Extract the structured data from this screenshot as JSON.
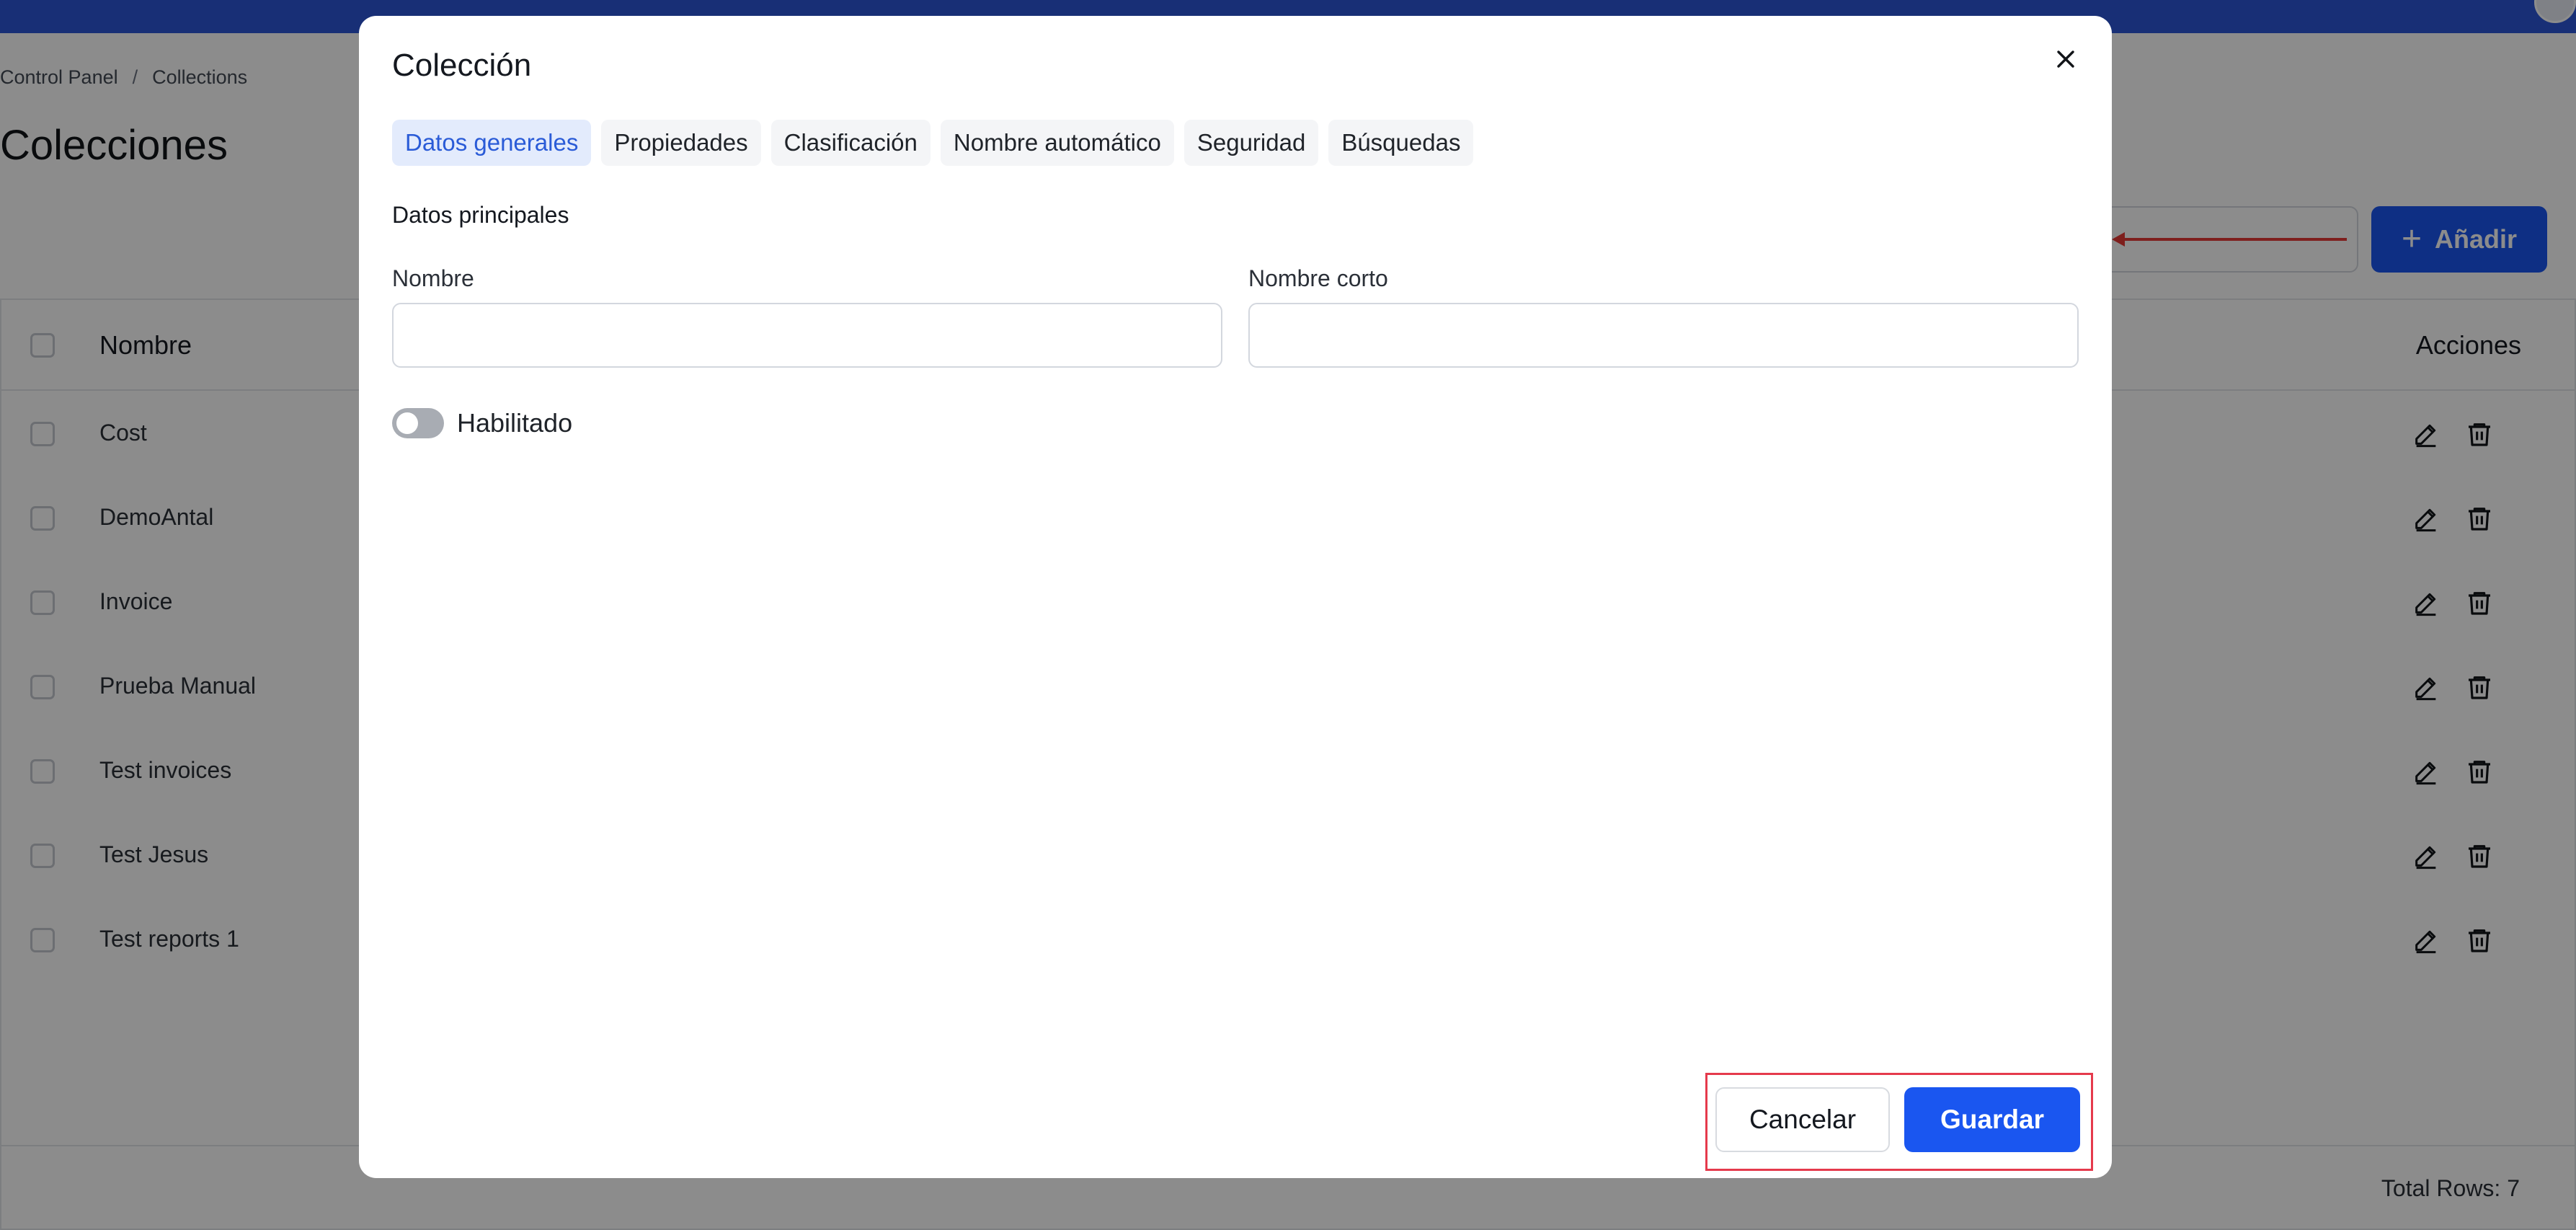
{
  "breadcrumb": {
    "root": "Control Panel",
    "separator": "/",
    "current": "Collections"
  },
  "page": {
    "title": "Colecciones"
  },
  "toolbar": {
    "add_label": "Añadir",
    "add_icon": "plus-icon"
  },
  "table": {
    "columns": {
      "name": "Nombre",
      "actions": "Acciones"
    },
    "rows": [
      {
        "name": "Cost"
      },
      {
        "name": "DemoAntal"
      },
      {
        "name": "Invoice"
      },
      {
        "name": "Prueba Manual"
      },
      {
        "name": "Test invoices"
      },
      {
        "name": "Test Jesus"
      },
      {
        "name": "Test reports 1"
      }
    ],
    "total_rows": "Total Rows: 7"
  },
  "modal": {
    "title": "Colección",
    "tabs": [
      {
        "label": "Datos generales",
        "active": true
      },
      {
        "label": "Propiedades"
      },
      {
        "label": "Clasificación"
      },
      {
        "label": "Nombre automático"
      },
      {
        "label": "Seguridad"
      },
      {
        "label": "Búsquedas"
      }
    ],
    "section_title": "Datos principales",
    "fields": {
      "nombre": {
        "label": "Nombre",
        "value": ""
      },
      "nombre_corto": {
        "label": "Nombre corto",
        "value": ""
      }
    },
    "toggle": {
      "label": "Habilitado",
      "checked": false
    },
    "buttons": {
      "cancel": "Cancelar",
      "save": "Guardar"
    }
  },
  "colors": {
    "primary": "#1a56f0",
    "topbar": "#2c57d8",
    "active_tab_bg": "#e3ebfc",
    "active_tab_text": "#2a5bd7",
    "highlight": "#e53a4c"
  }
}
